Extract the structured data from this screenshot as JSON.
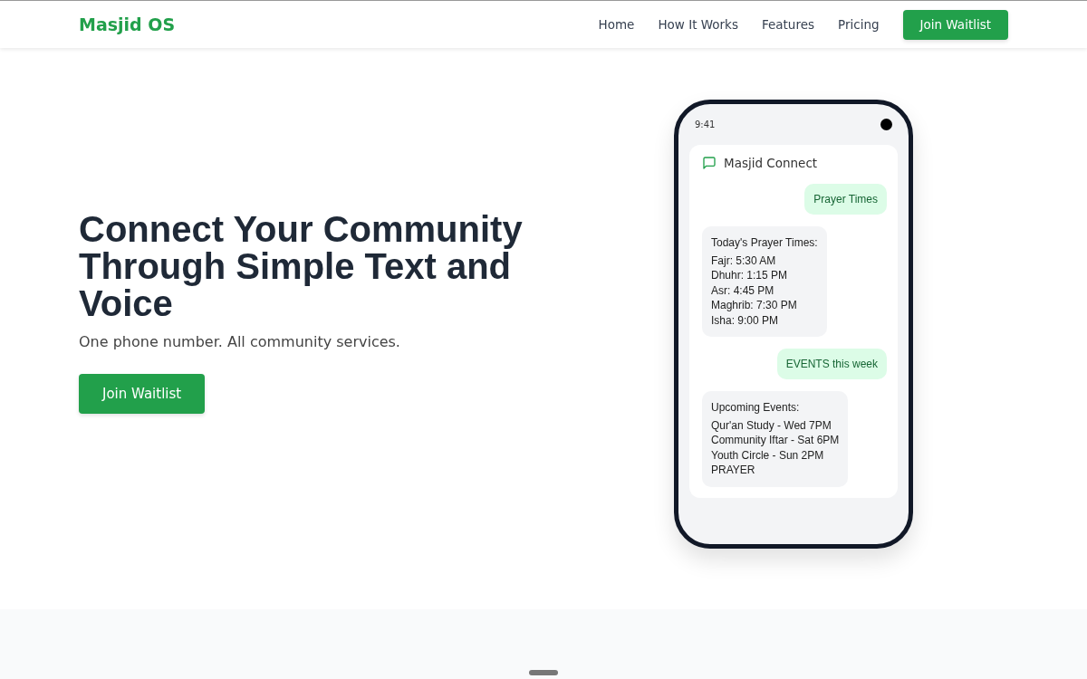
{
  "header": {
    "logo": "Masjid OS",
    "nav": [
      "Home",
      "How It Works",
      "Features",
      "Pricing"
    ],
    "cta": "Join Waitlist"
  },
  "hero": {
    "title": "Connect Your Community Through Simple Text and Voice",
    "subtitle": "One phone number. All community services.",
    "cta": "Join Waitlist"
  },
  "phone": {
    "time": "9:41",
    "app_title": "Masjid Connect",
    "messages": [
      {
        "kind": "sent",
        "title": "Prayer Times"
      },
      {
        "kind": "received",
        "title": "Today's Prayer Times:",
        "lines": [
          "Fajr: 5:30 AM",
          "Dhuhr: 1:15 PM",
          "Asr: 4:45 PM",
          "Maghrib: 7:30 PM",
          "Isha: 9:00 PM"
        ]
      },
      {
        "kind": "sent",
        "title": "EVENTS this week"
      },
      {
        "kind": "received",
        "title": "Upcoming Events:",
        "lines": [
          "Qur'an Study - Wed 7PM",
          "Community Iftar - Sat 6PM",
          "Youth Circle - Sun 2PM",
          "PRAYER"
        ]
      }
    ]
  }
}
